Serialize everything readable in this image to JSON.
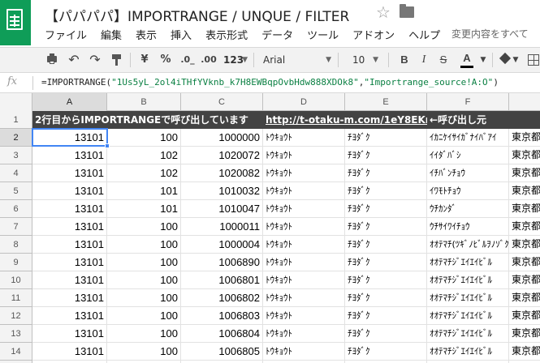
{
  "app": {
    "title": "【パパパパ】IMPORTRANGE / UNQUE / FILTER",
    "menu": [
      "ファイル",
      "編集",
      "表示",
      "挿入",
      "表示形式",
      "データ",
      "ツール",
      "アドオン",
      "ヘルプ"
    ],
    "last_edit": "変更内容をすべて"
  },
  "toolbar": {
    "currency": "¥",
    "percent": "%",
    "dec_decrease": ".0_",
    "dec_increase": ".00",
    "more_formats": "123",
    "font": "Arial",
    "font_size": "10",
    "bold": "B",
    "italic": "I",
    "strike": "S",
    "text_color": "A"
  },
  "formula_bar": {
    "fx": "fx",
    "prefix": "=IMPORTRANGE(",
    "arg1": "\"1Us5yL_2ol4iTHfYVknb_k7H8EWBqpOvbHdw888XDOk8\"",
    "comma": ",",
    "arg2": "\"Importrange_source!A:O\"",
    "suffix": ")"
  },
  "grid": {
    "columns": [
      "A",
      "B",
      "C",
      "D",
      "E",
      "F"
    ],
    "selected_column": "A",
    "selected_row": "2",
    "header_row": {
      "row_number": "1",
      "a": "2行目からIMPORTRANGEで呼び出しています",
      "d": "http://t-otaku-m.com/1eY8EKn",
      "f": "←呼び出し元"
    },
    "rows": [
      {
        "n": "2",
        "a": "13101",
        "b": "100",
        "c": "1000000",
        "d": "ﾄｳｷｮｳﾄ",
        "e": "ﾁﾖﾀﾞｸ",
        "f": "ｲｶﾆｹｲｻｲｶﾞﾅｲﾊﾞｱｲ",
        "g": "東京都"
      },
      {
        "n": "3",
        "a": "13101",
        "b": "102",
        "c": "1020072",
        "d": "ﾄｳｷｮｳﾄ",
        "e": "ﾁﾖﾀﾞｸ",
        "f": "ｲｲﾀﾞﾊﾞｼ",
        "g": "東京都"
      },
      {
        "n": "4",
        "a": "13101",
        "b": "102",
        "c": "1020082",
        "d": "ﾄｳｷｮｳﾄ",
        "e": "ﾁﾖﾀﾞｸ",
        "f": "ｲﾁﾊﾞﾝﾁｮｳ",
        "g": "東京都"
      },
      {
        "n": "5",
        "a": "13101",
        "b": "101",
        "c": "1010032",
        "d": "ﾄｳｷｮｳﾄ",
        "e": "ﾁﾖﾀﾞｸ",
        "f": "ｲﾜﾓﾄﾁｮｳ",
        "g": "東京都"
      },
      {
        "n": "6",
        "a": "13101",
        "b": "101",
        "c": "1010047",
        "d": "ﾄｳｷｮｳﾄ",
        "e": "ﾁﾖﾀﾞｸ",
        "f": "ｳﾁｶﾝﾀﾞ",
        "g": "東京都"
      },
      {
        "n": "7",
        "a": "13101",
        "b": "100",
        "c": "1000011",
        "d": "ﾄｳｷｮｳﾄ",
        "e": "ﾁﾖﾀﾞｸ",
        "f": "ｳﾁｻｲﾜｲﾁｮｳ",
        "g": "東京都"
      },
      {
        "n": "8",
        "a": "13101",
        "b": "100",
        "c": "1000004",
        "d": "ﾄｳｷｮｳﾄ",
        "e": "ﾁﾖﾀﾞｸ",
        "f": "ｵｵﾃﾏﾁ(ﾂｷﾞﾉﾋﾞﾙｦﾉｿﾞｸ)",
        "g": "東京都"
      },
      {
        "n": "9",
        "a": "13101",
        "b": "100",
        "c": "1006890",
        "d": "ﾄｳｷｮｳﾄ",
        "e": "ﾁﾖﾀﾞｸ",
        "f": "ｵｵﾃﾏﾁｼﾞｴｲｴｲﾋﾞﾙ",
        "g": "東京都"
      },
      {
        "n": "10",
        "a": "13101",
        "b": "100",
        "c": "1006801",
        "d": "ﾄｳｷｮｳﾄ",
        "e": "ﾁﾖﾀﾞｸ",
        "f": "ｵｵﾃﾏﾁｼﾞｴｲｴｲﾋﾞﾙ",
        "g": "東京都"
      },
      {
        "n": "11",
        "a": "13101",
        "b": "100",
        "c": "1006802",
        "d": "ﾄｳｷｮｳﾄ",
        "e": "ﾁﾖﾀﾞｸ",
        "f": "ｵｵﾃﾏﾁｼﾞｴｲｴｲﾋﾞﾙ",
        "g": "東京都"
      },
      {
        "n": "12",
        "a": "13101",
        "b": "100",
        "c": "1006803",
        "d": "ﾄｳｷｮｳﾄ",
        "e": "ﾁﾖﾀﾞｸ",
        "f": "ｵｵﾃﾏﾁｼﾞｴｲｴｲﾋﾞﾙ",
        "g": "東京都"
      },
      {
        "n": "13",
        "a": "13101",
        "b": "100",
        "c": "1006804",
        "d": "ﾄｳｷｮｳﾄ",
        "e": "ﾁﾖﾀﾞｸ",
        "f": "ｵｵﾃﾏﾁｼﾞｴｲｴｲﾋﾞﾙ",
        "g": "東京都"
      },
      {
        "n": "14",
        "a": "13101",
        "b": "100",
        "c": "1006805",
        "d": "ﾄｳｷｮｳﾄ",
        "e": "ﾁﾖﾀﾞｸ",
        "f": "ｵｵﾃﾏﾁｼﾞｴｲｴｲﾋﾞﾙ",
        "g": "東京都"
      },
      {
        "n": "15",
        "a": "13101",
        "b": "100",
        "c": "1006806",
        "d": "ﾄｳｷｮｳﾄ",
        "e": "ﾁﾖﾀﾞｸ",
        "f": "ｵｵﾃﾏﾁｼﾞｴｲｴｲﾋﾞﾙ",
        "g": "東京都"
      }
    ]
  },
  "colors": {
    "brand_green": "#0f9d58",
    "header_row_bg": "#434343",
    "selection_blue": "#4285f4"
  }
}
